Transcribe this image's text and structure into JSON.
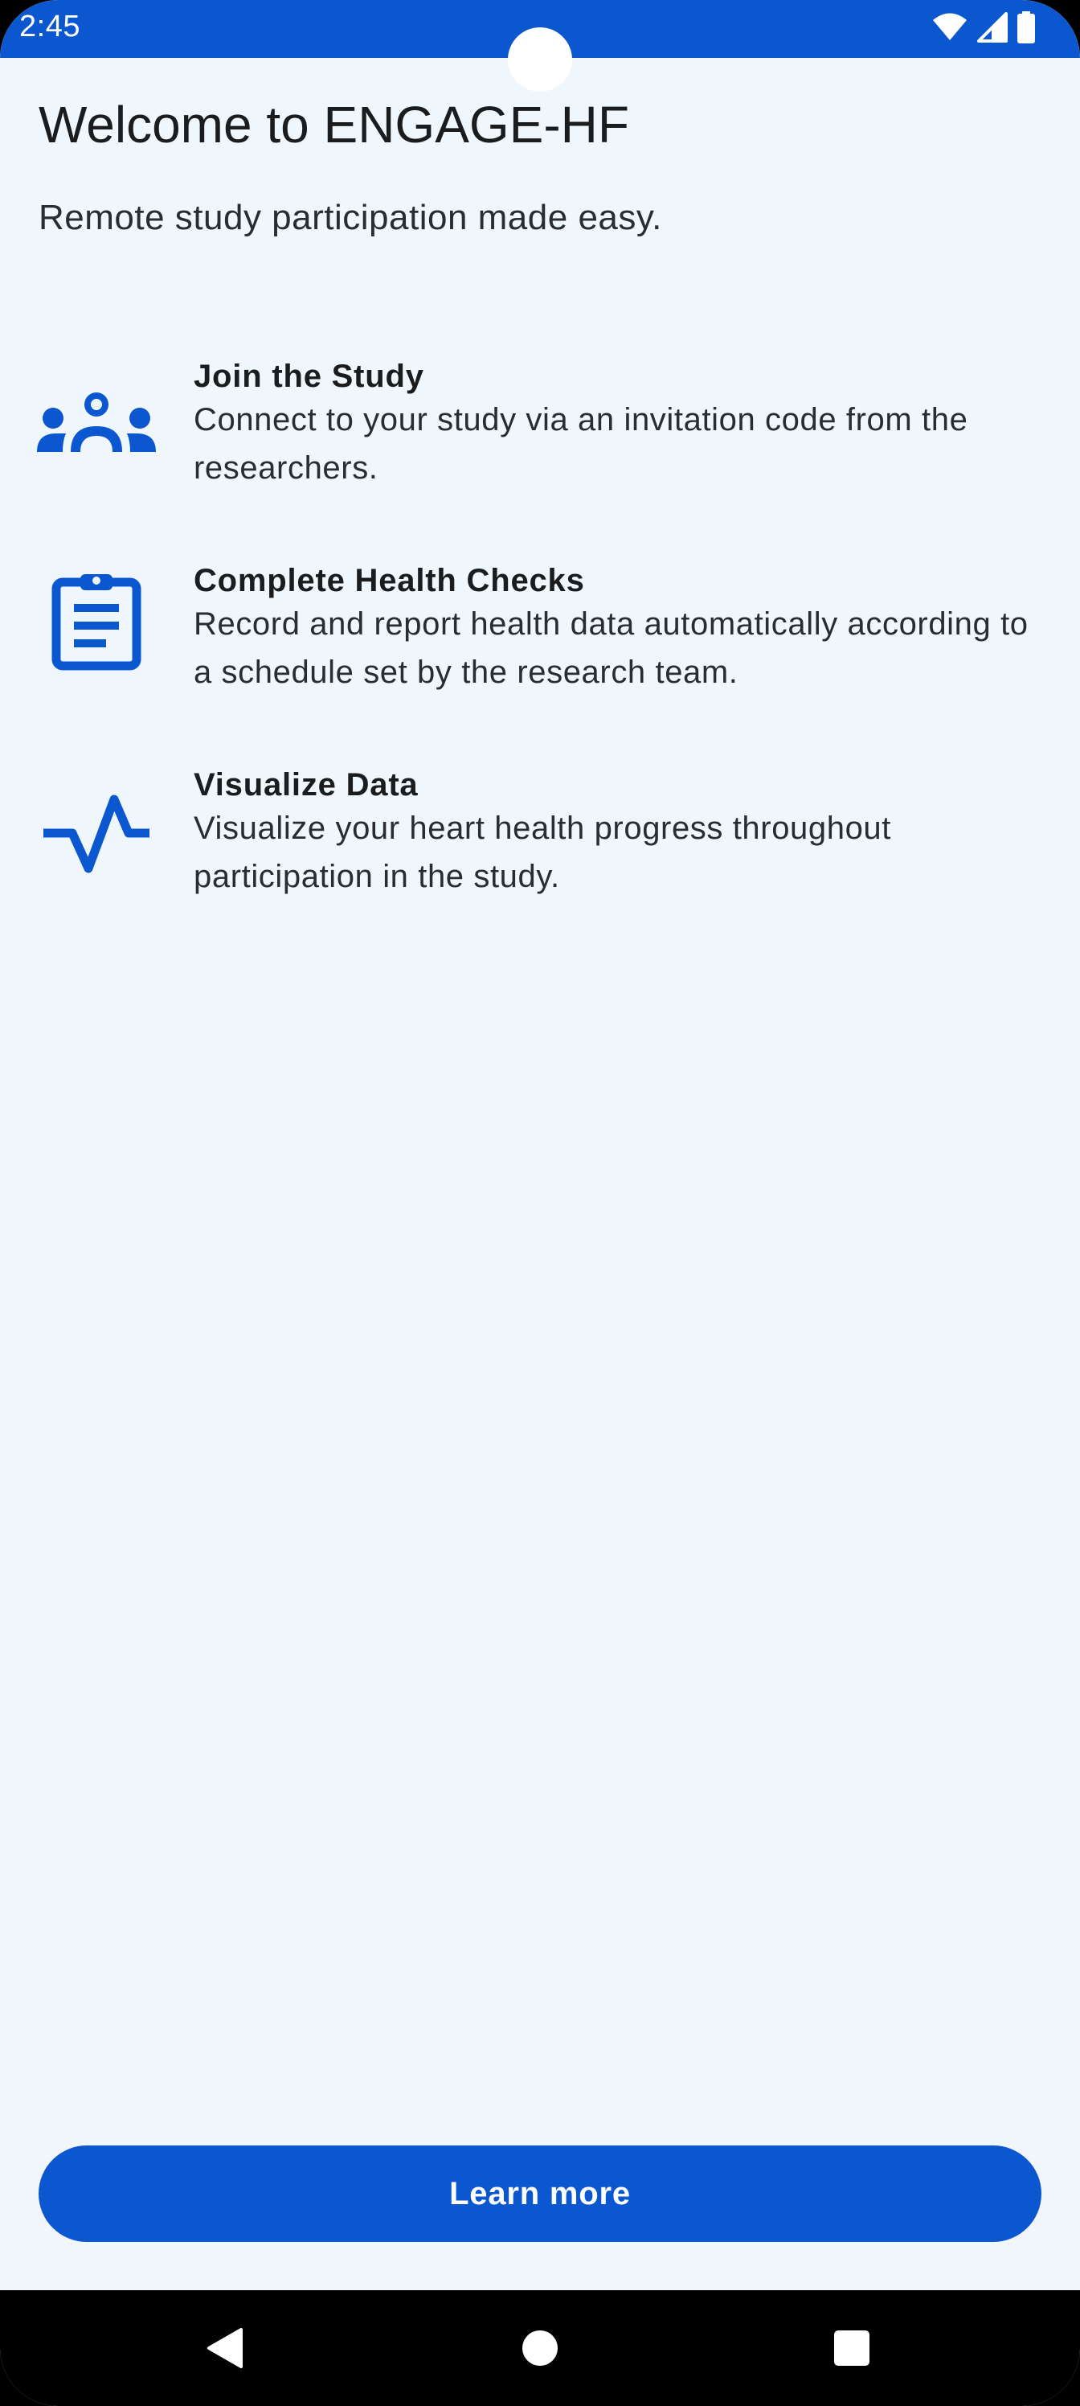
{
  "status_bar": {
    "time": "2:45",
    "icons": [
      "wifi-icon",
      "cell-signal-icon",
      "battery-icon"
    ]
  },
  "header": {
    "title": "Welcome to ENGAGE-HF",
    "subtitle": "Remote study participation made easy."
  },
  "features": [
    {
      "icon": "groups-icon",
      "title": "Join the Study",
      "description": "Connect to your study via an invitation code from the researchers."
    },
    {
      "icon": "clipboard-icon",
      "title": "Complete Health Checks",
      "description": "Record and report health data automatically according to a schedule set by the research team."
    },
    {
      "icon": "heartbeat-icon",
      "title": "Visualize Data",
      "description": "Visualize your heart health progress throughout participation in the study."
    }
  ],
  "actions": {
    "learn_more_label": "Learn more"
  },
  "navigation": {
    "buttons": [
      "back-icon",
      "home-icon",
      "recents-icon"
    ]
  },
  "colors": {
    "accent": "#0b57d0",
    "background": "#eff7fd",
    "text": "#1b1c1e"
  }
}
